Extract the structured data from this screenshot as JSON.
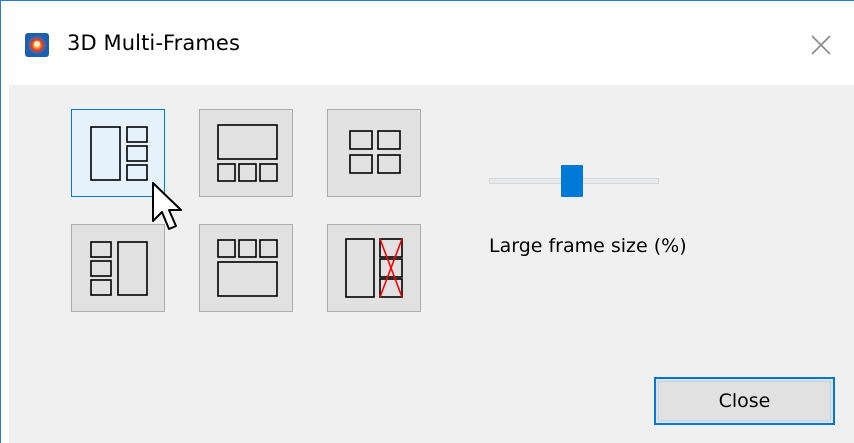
{
  "window": {
    "title": "3D Multi-Frames"
  },
  "icons": {
    "app": "app-logo-icon",
    "close": "close-icon",
    "cursor": "mouse-pointer-icon"
  },
  "layouts": [
    {
      "name": "layout-large-left-three-right",
      "selected": true
    },
    {
      "name": "layout-large-top-three-bottom",
      "selected": false
    },
    {
      "name": "layout-four-grid",
      "selected": false
    },
    {
      "name": "layout-three-left-large-right",
      "selected": false
    },
    {
      "name": "layout-three-top-large-bottom",
      "selected": false
    },
    {
      "name": "layout-large-left-crossed-right",
      "selected": false
    }
  ],
  "slider": {
    "label": "Large frame size (%)",
    "value_fraction": 0.5
  },
  "buttons": {
    "close_label": "Close"
  },
  "colors": {
    "accent": "#0078d7",
    "dialog_bg": "#f0f0f0",
    "button_bg": "#e1e1e1",
    "selected_bg": "#e5f1fb",
    "cross_red": "#ff0000"
  }
}
